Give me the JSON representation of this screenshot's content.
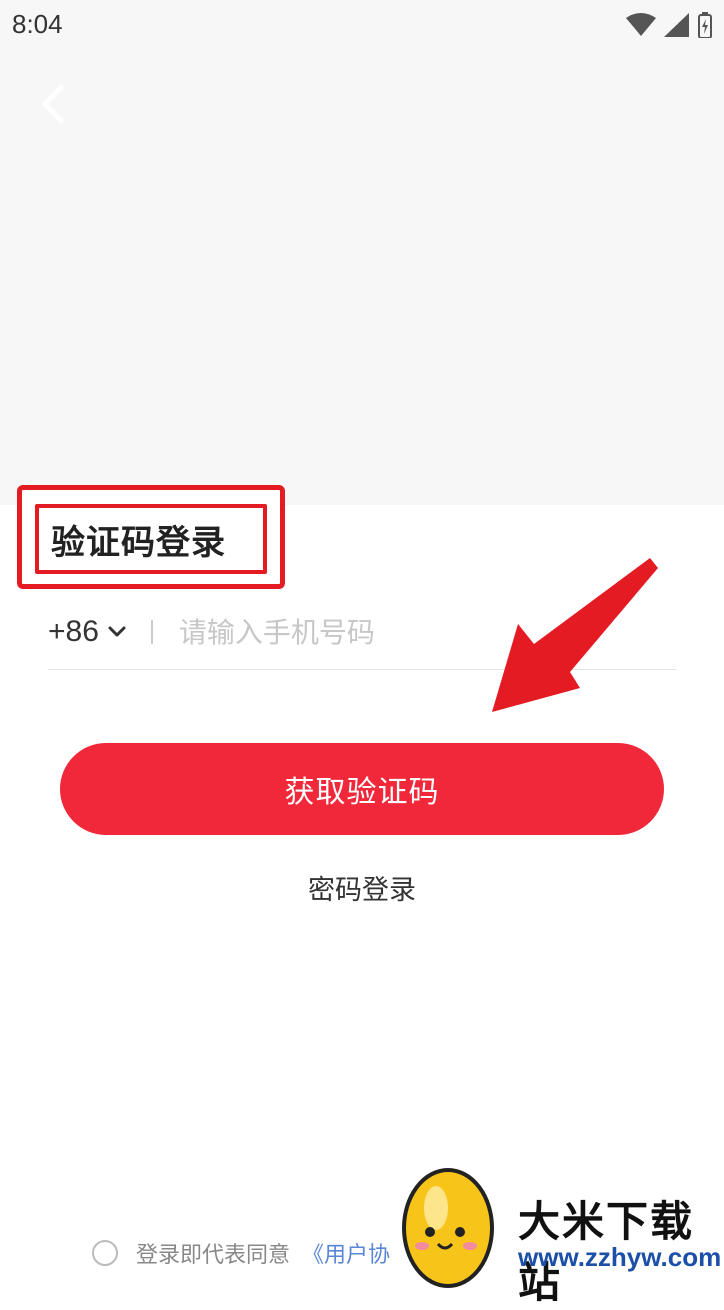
{
  "status_bar": {
    "time": "8:04",
    "icons": [
      "wifi-icon",
      "cellular-icon",
      "battery-icon"
    ]
  },
  "header": {
    "back_icon": "chevron-left-icon"
  },
  "login": {
    "title": "验证码登录",
    "country_code": "+86",
    "country_code_icon": "chevron-down-icon",
    "phone_placeholder": "请输入手机号码",
    "get_code_label": "获取验证码",
    "password_login_label": "密码登录"
  },
  "agreement": {
    "text": "登录即代表同意",
    "link": "《用户协"
  },
  "watermark": {
    "name": "大米下载站",
    "url": "www.zzhyw.com"
  },
  "colors": {
    "accent": "#f1273a",
    "annotation": "#e51b24",
    "link": "#5a86d6"
  }
}
